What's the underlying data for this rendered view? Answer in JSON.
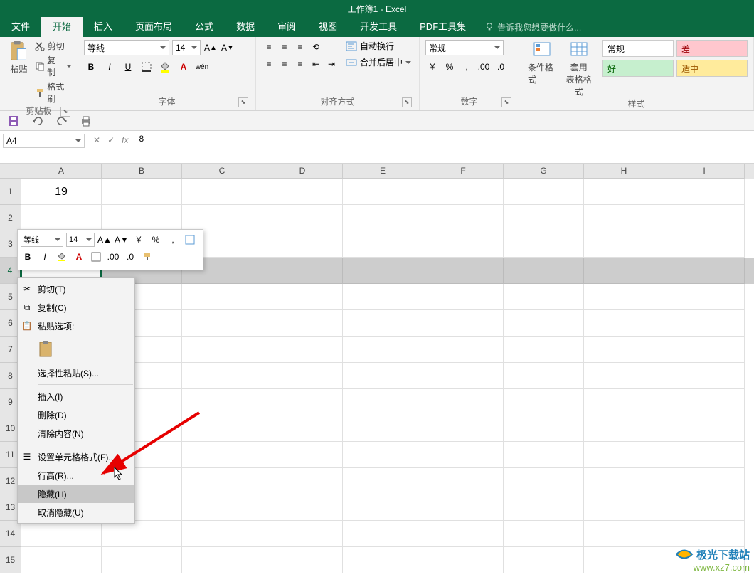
{
  "title": "工作簿1 - Excel",
  "tabs": {
    "file": "文件",
    "home": "开始",
    "insert": "插入",
    "layout": "页面布局",
    "formula": "公式",
    "data": "数据",
    "review": "审阅",
    "view": "视图",
    "dev": "开发工具",
    "pdf": "PDF工具集"
  },
  "tell_me": "告诉我您想要做什么...",
  "clipboard": {
    "paste": "粘贴",
    "cut": "剪切",
    "copy": "复制",
    "painter": "格式刷",
    "label": "剪贴板"
  },
  "font": {
    "name": "等线",
    "size": "14",
    "label": "字体"
  },
  "align": {
    "wrap": "自动换行",
    "merge": "合并后居中",
    "label": "对齐方式"
  },
  "number": {
    "format": "常规",
    "label": "数字"
  },
  "styles": {
    "cond": "条件格式",
    "table": "套用\n表格格式",
    "normal": "常规",
    "bad": "差",
    "good": "好",
    "neutral": "适中",
    "label": "样式"
  },
  "name_box": "A4",
  "formula_value": "8",
  "columns": [
    "A",
    "B",
    "C",
    "D",
    "E",
    "F",
    "G",
    "H",
    "I"
  ],
  "rows": [
    "1",
    "2",
    "3",
    "4",
    "5",
    "6",
    "7",
    "8",
    "9",
    "10",
    "11",
    "12",
    "13",
    "14",
    "15"
  ],
  "cell_a1": "19",
  "selected_row_index": 3,
  "mini": {
    "font": "等线",
    "size": "14"
  },
  "ctx": {
    "cut": "剪切(T)",
    "copy": "复制(C)",
    "paste_opt": "粘贴选项:",
    "paste_special": "选择性粘贴(S)...",
    "insert": "插入(I)",
    "delete": "删除(D)",
    "clear": "清除内容(N)",
    "format": "设置单元格格式(F)...",
    "row_height": "行高(R)...",
    "hide": "隐藏(H)",
    "unhide": "取消隐藏(U)"
  },
  "watermark": {
    "brand": "极光下载站",
    "url": "www.xz7.com"
  }
}
